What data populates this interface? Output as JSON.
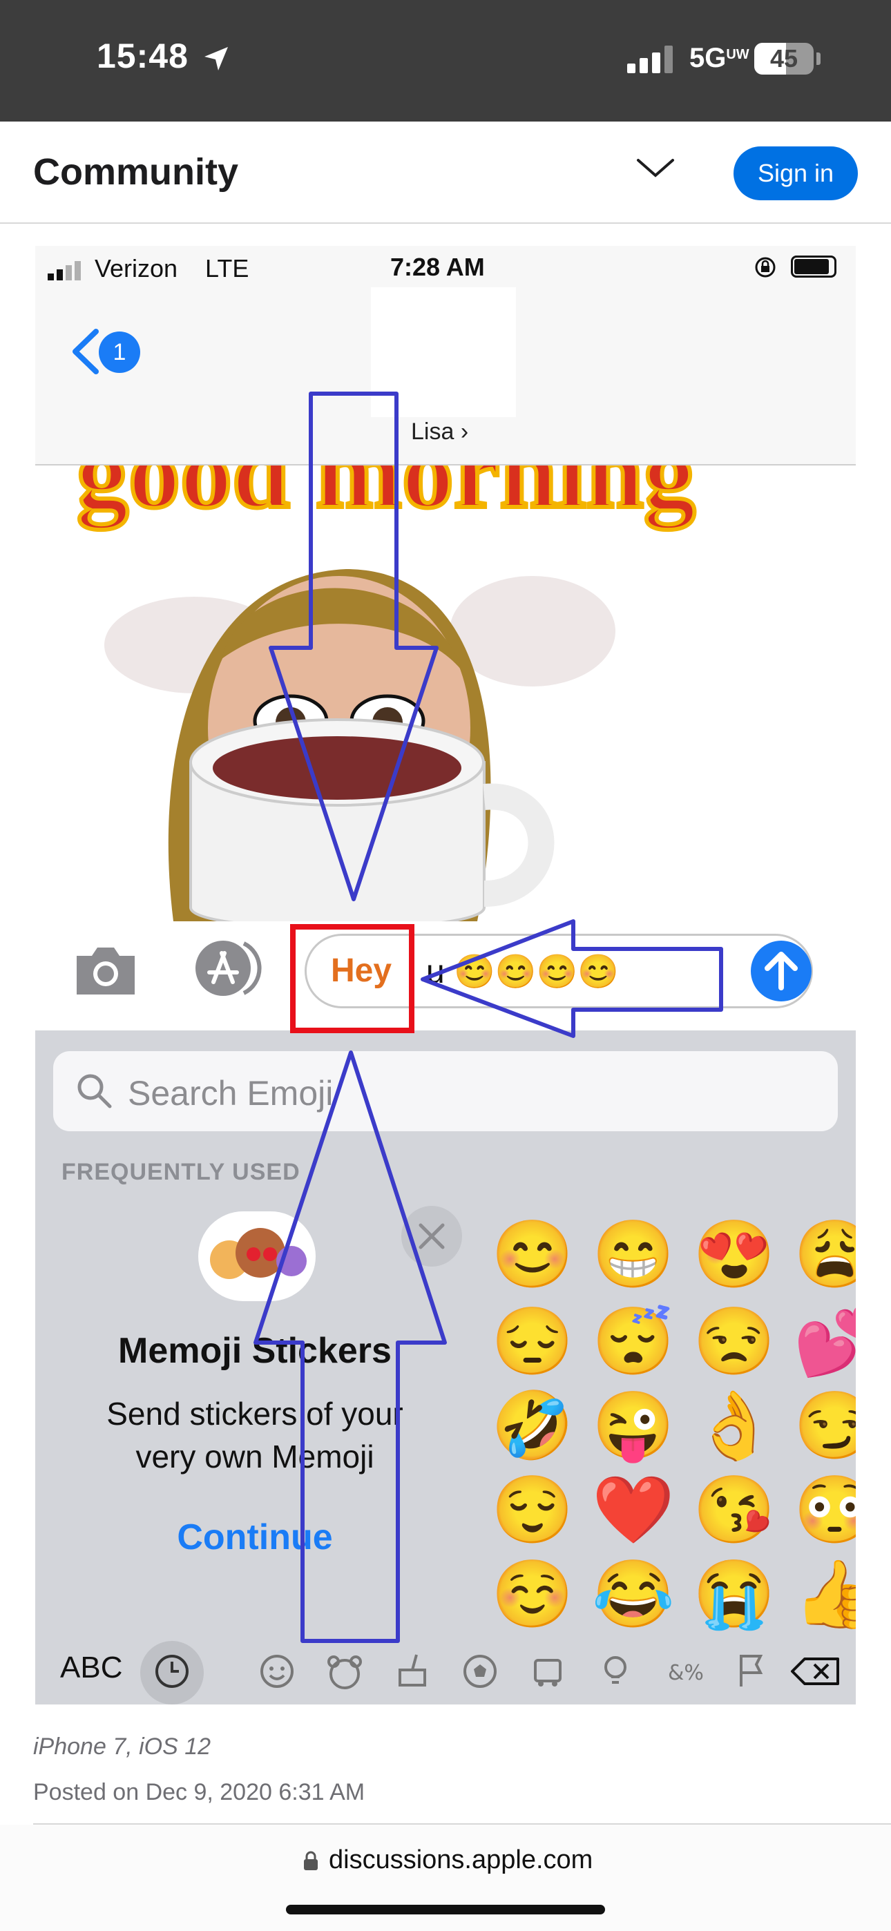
{
  "status_bar": {
    "time": "15:48",
    "network": "5G",
    "network_sup": "UW",
    "battery": "45"
  },
  "header": {
    "title": "Community",
    "sign_in": "Sign in"
  },
  "embedded": {
    "carrier": "Verizon",
    "network": "LTE",
    "time": "7:28 AM",
    "back_badge": "1",
    "contact_name": "Lisa ›",
    "message_hey": "Hey",
    "message_rest": "u 😊😊😊😊",
    "search_placeholder": "Search Emoji",
    "frequently_used": "FREQUENTLY USED",
    "memoji_title": "Memoji Stickers",
    "memoji_desc": "Send stickers of your very own Memoji",
    "memoji_continue": "Continue",
    "emojis": [
      [
        "😊",
        "😁",
        "😍",
        "😩"
      ],
      [
        "😔",
        "😴",
        "😒",
        "💕"
      ],
      [
        "🤣",
        "😜",
        "👌",
        "😏"
      ],
      [
        "😌",
        "❤️",
        "😘",
        "😳"
      ],
      [
        "☺️",
        "😂",
        "😭",
        "👍"
      ]
    ],
    "keyboard_abc": "ABC",
    "sticker_text": "good morning"
  },
  "post": {
    "device": "iPhone 7, iOS 12",
    "date": "Posted on Dec 9, 2020 6:31 AM"
  },
  "url_bar": {
    "url": "discussions.apple.com"
  },
  "colors": {
    "accent": "#0071e3",
    "annotation_blue": "#3b3bc9",
    "annotation_red": "#e8101a",
    "ios_blue": "#1a7cf6"
  }
}
